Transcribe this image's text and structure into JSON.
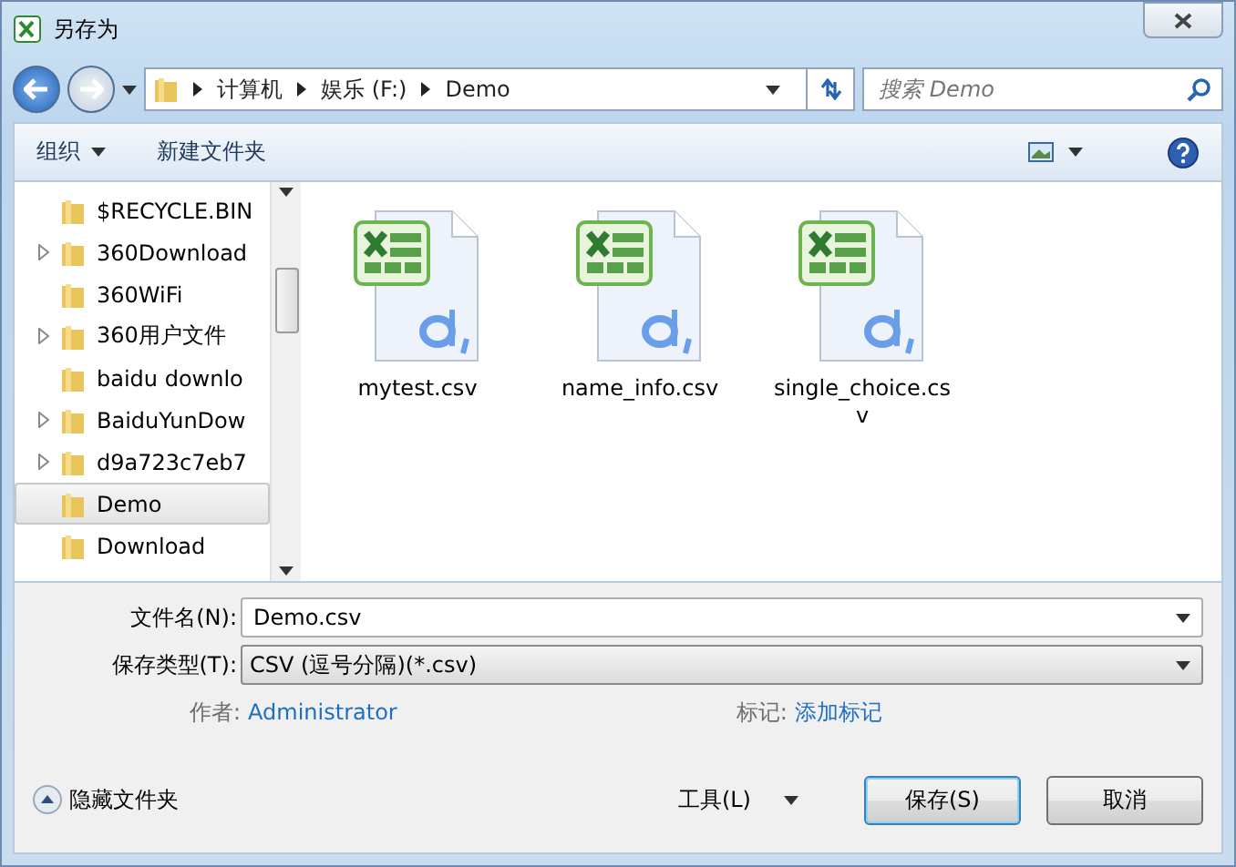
{
  "window": {
    "title": "另存为"
  },
  "address": {
    "crumbs": [
      "计算机",
      "娱乐 (F:)",
      "Demo"
    ]
  },
  "search": {
    "placeholder": "搜索 Demo"
  },
  "toolbar": {
    "organize": "组织",
    "new_folder": "新建文件夹"
  },
  "tree": [
    {
      "label": "$RECYCLE.BIN",
      "expandable": false,
      "selected": false
    },
    {
      "label": "360Download",
      "expandable": true,
      "selected": false
    },
    {
      "label": "360WiFi",
      "expandable": false,
      "selected": false
    },
    {
      "label": "360用户文件",
      "expandable": true,
      "selected": false
    },
    {
      "label": "baidu downlo",
      "expandable": false,
      "selected": false
    },
    {
      "label": "BaiduYunDow",
      "expandable": true,
      "selected": false
    },
    {
      "label": "d9a723c7eb7",
      "expandable": true,
      "selected": false
    },
    {
      "label": "Demo",
      "expandable": false,
      "selected": true
    },
    {
      "label": "Download",
      "expandable": false,
      "selected": false
    }
  ],
  "files": [
    {
      "name": "mytest.csv"
    },
    {
      "name": "name_info.csv"
    },
    {
      "name": "single_choice.csv"
    }
  ],
  "filename": {
    "label": "文件名(N):",
    "value": "Demo.csv"
  },
  "filetype": {
    "label": "保存类型(T):",
    "value": "CSV (逗号分隔)(*.csv)"
  },
  "author": {
    "label": "作者:",
    "value": "Administrator"
  },
  "tags": {
    "label": "标记:",
    "value": "添加标记"
  },
  "hide_folders": "隐藏文件夹",
  "tools": "工具(L)",
  "buttons": [
    {
      "label": "保存(S)",
      "kind": "primary"
    },
    {
      "label": "取消",
      "kind": "normal"
    }
  ]
}
